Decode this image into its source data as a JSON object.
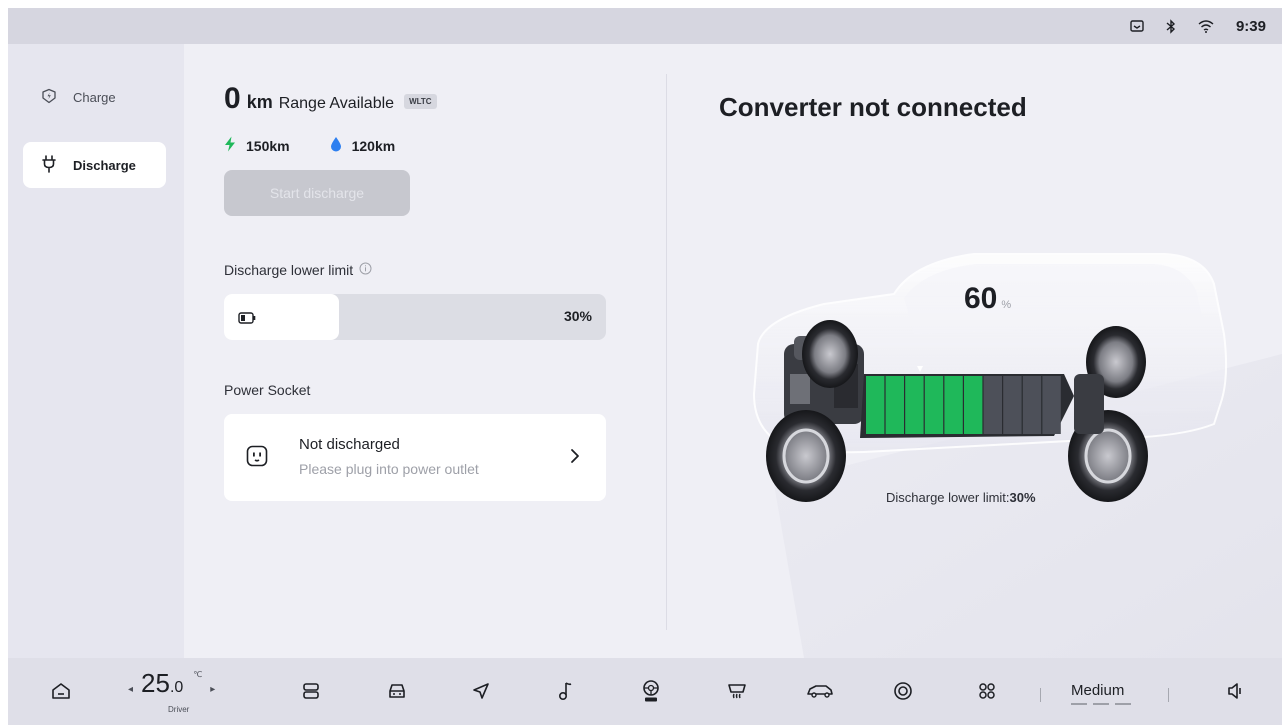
{
  "status_bar": {
    "icons": [
      "message-icon",
      "bluetooth-icon",
      "wifi-icon"
    ],
    "time": "9:39"
  },
  "sidebar": {
    "items": [
      {
        "label": "Charge",
        "icon": "charge-shield-icon",
        "active": false
      },
      {
        "label": "Discharge",
        "icon": "plug-icon",
        "active": true
      }
    ]
  },
  "range": {
    "value": "0",
    "unit": "km",
    "label": "Range Available",
    "badge": "WLTC",
    "electric": "150km",
    "fuel": "120km"
  },
  "start_button": {
    "label": "Start discharge",
    "enabled": false
  },
  "discharge_limit": {
    "label": "Discharge lower limit",
    "value_text": "30%",
    "value": 0.3
  },
  "power_socket": {
    "label": "Power Socket",
    "title": "Not discharged",
    "subtitle": "Please plug into power outlet"
  },
  "converter": {
    "title": "Converter not connected"
  },
  "battery": {
    "percent": "60",
    "unit": "%",
    "level": 0.6,
    "limit_label": "Discharge lower limit:",
    "limit_value": "30%"
  },
  "dock": {
    "temperature": {
      "integer": "25",
      "decimal": ".0",
      "unit": "℃",
      "label": "Driver"
    },
    "icons": [
      "home-icon",
      "seat-icon",
      "car-icon",
      "navigation-icon",
      "music-icon",
      "steering-off-icon",
      "rear-defrost-icon",
      "car-side-icon",
      "camera-icon",
      "apps-icon",
      "volume-icon"
    ],
    "fan_mode": "Medium"
  },
  "colors": {
    "accent_green": "#1fb85a",
    "water_blue": "#2d7ff0",
    "battery_empty": "#4d5059"
  }
}
